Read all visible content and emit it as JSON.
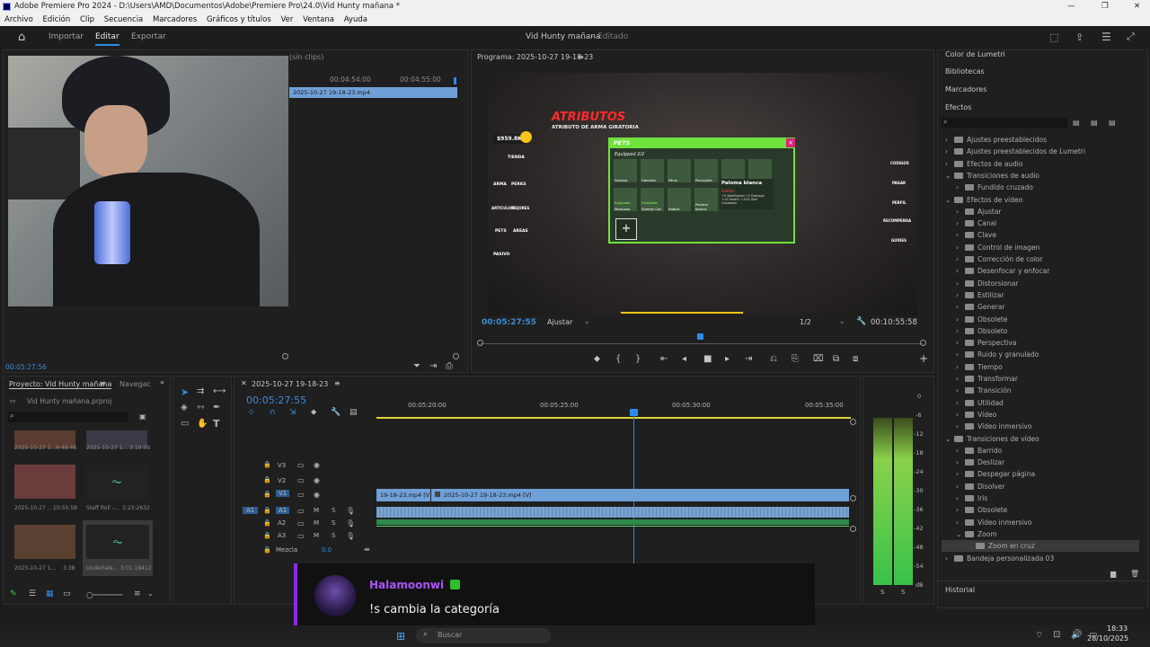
{
  "window": {
    "title": "Adobe Premiere Pro 2024 - D:\\Users\\AMD\\Documentos\\Adobe\\Premiere Pro\\24.0\\Vid Hunty mañana *",
    "controls": [
      "—",
      "❐",
      "✕"
    ]
  },
  "menu": [
    "Archivo",
    "Edición",
    "Clip",
    "Secuencia",
    "Marcadores",
    "Gráficos y títulos",
    "Ver",
    "Ventana",
    "Ayuda"
  ],
  "workspace": {
    "tabs": [
      "Importar",
      "Editar",
      "Exportar"
    ],
    "active_tab": "Editar",
    "project_title": "Vid Hunty mañana",
    "project_status": "- Editado"
  },
  "source_monitor": {
    "header_suffix": "(sin clips)",
    "ruler": [
      "00:04:54:00",
      "00:04:55:00"
    ],
    "clip_label": "2025-10-27 19-18-23.mp4",
    "timecode": "00:05:27:56"
  },
  "program_monitor": {
    "title": "Programa: 2025-10-27 19-18-23",
    "timecode": "00:05:27:55",
    "fit": "Ajustar",
    "quality": "1/2",
    "duration": "00:10:55:58"
  },
  "game": {
    "title": "ATRIBUTOS",
    "subtitle": "ATRIBUTO DE ARMA GIRATORIA",
    "money": "$959.8K",
    "left_menu": [
      "TIENDA",
      "ARMA",
      "PERKS",
      "ARTICULOS",
      "MEJORES",
      "PETS",
      "AREAS",
      "PASIVO"
    ],
    "right_menu": [
      "CODIGOS",
      "PAGAR",
      "PERFIL",
      "RECOMPENSA",
      "GUIDES"
    ],
    "pets_title": "PETS",
    "equipped": "Equipped 2/2",
    "pets": [
      "Gusano",
      "Hamster",
      "Fénix",
      "Porcupine",
      "",
      ""
    ],
    "pets_row2": [
      "Equipado",
      "Equipado",
      "Rabbit",
      "Paloma blanca"
    ],
    "pets_row2b": [
      "Mariposa",
      "Speedy Cat",
      "",
      ""
    ],
    "selected_pet": "Paloma blanca",
    "selected_rarity": "Exótico",
    "selected_stats": "+5 WalkSpeed +2 Damage +10 Health +10% Skill Cooldown",
    "add_label": "+"
  },
  "project_panel": {
    "tab": "Proyecto: Vid Hunty mañana",
    "tab2": "Navegac",
    "file": "Vid Hunty mañana.prproj",
    "items": [
      {
        "name": "2025-10-27 1...",
        "dur": "9:48:46"
      },
      {
        "name": "2025-10-27 1...",
        "dur": "3:19:09"
      },
      {
        "name": "2025-10-27 ...",
        "dur": "10:55:58"
      },
      {
        "name": "Staff Roll -...",
        "dur": "3:23:2632"
      },
      {
        "name": "2025-10-27 1...",
        "dur": "3:38"
      },
      {
        "name": "Undertale...",
        "dur": "3:01:18412"
      }
    ]
  },
  "timeline": {
    "sequence": "2025-10-27 19-18-23",
    "timecode": "00:05:27:55",
    "ruler": [
      "00:05:20:00",
      "00:05:25:00",
      "00:05:30:00",
      "00:05:35:00"
    ],
    "tracks_video": [
      "V3",
      "V2",
      "V1"
    ],
    "tracks_audio": [
      "A1",
      "A2",
      "A3"
    ],
    "source_audio": "A1",
    "mix_label": "Mezcla",
    "mix_value": "0.0",
    "clip_v1a": "19-18-23.mp4 [V]",
    "clip_v1b": "2025-10-27 19-18-23.mp4 [V]",
    "track_btns": [
      "M",
      "S"
    ]
  },
  "meters": {
    "scale": [
      "0",
      "-6",
      "-12",
      "-18",
      "-24",
      "-30",
      "-36",
      "-42",
      "-48",
      "-54",
      "dB"
    ],
    "solo": [
      "S",
      "S"
    ]
  },
  "effects_panel": {
    "top_tabs": [
      "Color de Lumetri",
      "Bibliotecas",
      "Marcadores"
    ],
    "title": "Efectos",
    "tree": [
      {
        "label": "Ajustes preestablecidos",
        "indent": 0,
        "exp": "›"
      },
      {
        "label": "Ajustes preestablecidos de Lumetri",
        "indent": 0,
        "exp": "›"
      },
      {
        "label": "Efectos de audio",
        "indent": 0,
        "exp": "›"
      },
      {
        "label": "Transiciones de audio",
        "indent": 0,
        "exp": "⌄"
      },
      {
        "label": "Fundido cruzado",
        "indent": 1,
        "exp": "›"
      },
      {
        "label": "Efectos de vídeo",
        "indent": 0,
        "exp": "⌄"
      },
      {
        "label": "Ajustar",
        "indent": 1,
        "exp": "›"
      },
      {
        "label": "Canal",
        "indent": 1,
        "exp": "›"
      },
      {
        "label": "Clave",
        "indent": 1,
        "exp": "›"
      },
      {
        "label": "Control de imagen",
        "indent": 1,
        "exp": "›"
      },
      {
        "label": "Corrección de color",
        "indent": 1,
        "exp": "›"
      },
      {
        "label": "Desenfocar y enfocar",
        "indent": 1,
        "exp": "›"
      },
      {
        "label": "Distorsionar",
        "indent": 1,
        "exp": "›"
      },
      {
        "label": "Estilizar",
        "indent": 1,
        "exp": "›"
      },
      {
        "label": "Generar",
        "indent": 1,
        "exp": "›"
      },
      {
        "label": "Obsolete",
        "indent": 1,
        "exp": "›"
      },
      {
        "label": "Obsoleto",
        "indent": 1,
        "exp": "›"
      },
      {
        "label": "Perspectiva",
        "indent": 1,
        "exp": "›"
      },
      {
        "label": "Ruido y granulado",
        "indent": 1,
        "exp": "›"
      },
      {
        "label": "Tiempo",
        "indent": 1,
        "exp": "›"
      },
      {
        "label": "Transformar",
        "indent": 1,
        "exp": "›"
      },
      {
        "label": "Transición",
        "indent": 1,
        "exp": "›"
      },
      {
        "label": "Utilidad",
        "indent": 1,
        "exp": "›"
      },
      {
        "label": "Vídeo",
        "indent": 1,
        "exp": "›"
      },
      {
        "label": "Vídeo inmersivo",
        "indent": 1,
        "exp": "›"
      },
      {
        "label": "Transiciones de vídeo",
        "indent": 0,
        "exp": "⌄"
      },
      {
        "label": "Barrido",
        "indent": 1,
        "exp": "›"
      },
      {
        "label": "Deslizar",
        "indent": 1,
        "exp": "›"
      },
      {
        "label": "Despegar página",
        "indent": 1,
        "exp": "›"
      },
      {
        "label": "Disolver",
        "indent": 1,
        "exp": "›"
      },
      {
        "label": "Iris",
        "indent": 1,
        "exp": "›"
      },
      {
        "label": "Obsolete",
        "indent": 1,
        "exp": "›"
      },
      {
        "label": "Vídeo inmersivo",
        "indent": 1,
        "exp": "›"
      },
      {
        "label": "Zoom",
        "indent": 1,
        "exp": "⌄"
      },
      {
        "label": "Zoom en cruz",
        "indent": 2,
        "exp": ""
      },
      {
        "label": "Bandeja personalizada 03",
        "indent": 0,
        "exp": "›"
      }
    ],
    "history": "Historial"
  },
  "chat": {
    "user": "Halamoonwi",
    "message": "!s cambia la categoría",
    "accent": "#a855f7"
  },
  "taskbar": {
    "search": "Buscar",
    "time": "18:33",
    "date": "28/10/2025"
  }
}
